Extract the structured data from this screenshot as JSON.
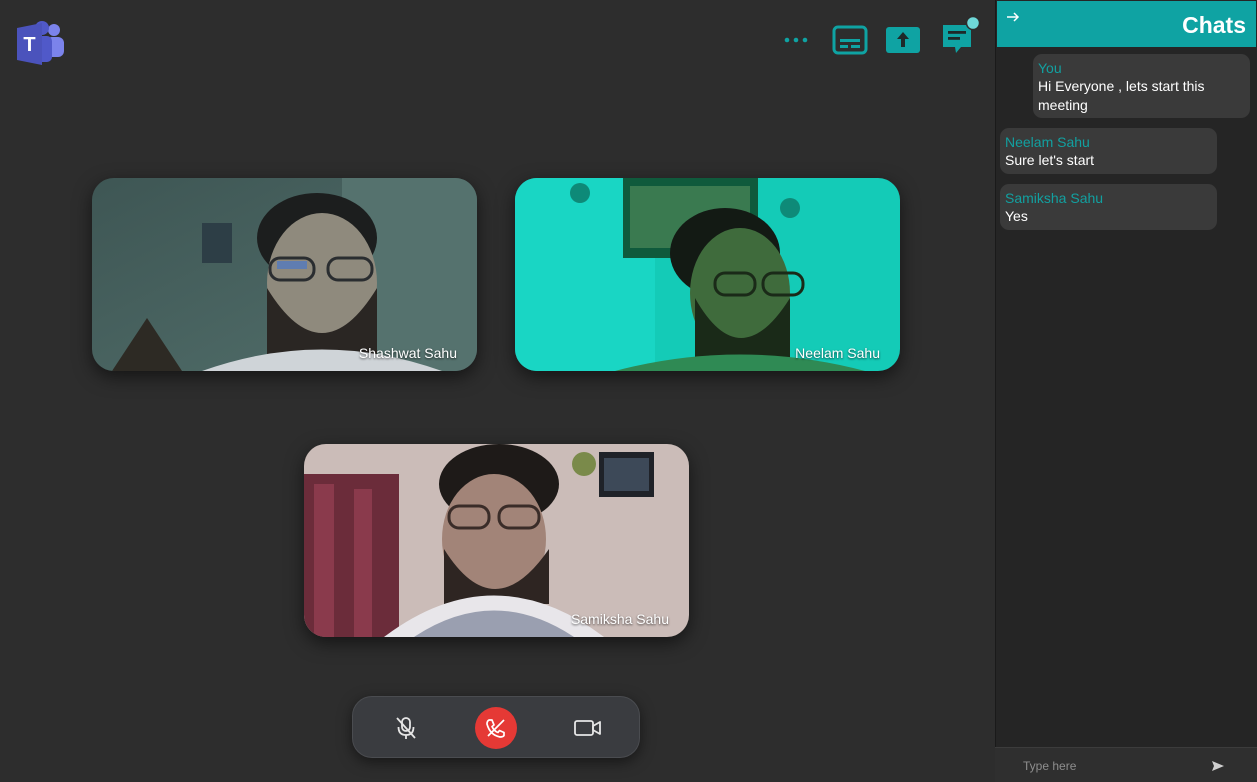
{
  "app": {
    "name": "Teams",
    "accent_color": "#0fa3a3",
    "end_call_color": "#e53935"
  },
  "toolbar": {
    "more_icon": "more-horizontal-icon",
    "captions_icon": "captions-icon",
    "share_icon": "share-screen-icon",
    "chat_icon": "chat-icon",
    "chat_has_notification": true
  },
  "participants": [
    {
      "name": "Shashwat Sahu",
      "tint": "#4a6a66"
    },
    {
      "name": "Neelam Sahu",
      "tint": "#14c9b4"
    },
    {
      "name": "Samiksha Sahu",
      "tint": "#c7b3b0"
    }
  ],
  "controls": {
    "mic_icon": "mic-off-icon",
    "end_call_icon": "end-call-icon",
    "camera_icon": "video-camera-icon"
  },
  "chat": {
    "title": "Chats",
    "messages": [
      {
        "sender": "You",
        "text": "Hi Everyone , lets start this meeting"
      },
      {
        "sender": "Neelam Sahu",
        "text": "Sure let's start"
      },
      {
        "sender": "Samiksha Sahu",
        "text": "Yes"
      }
    ],
    "input": {
      "placeholder": "Type here",
      "value": ""
    },
    "send_icon": "send-icon"
  }
}
